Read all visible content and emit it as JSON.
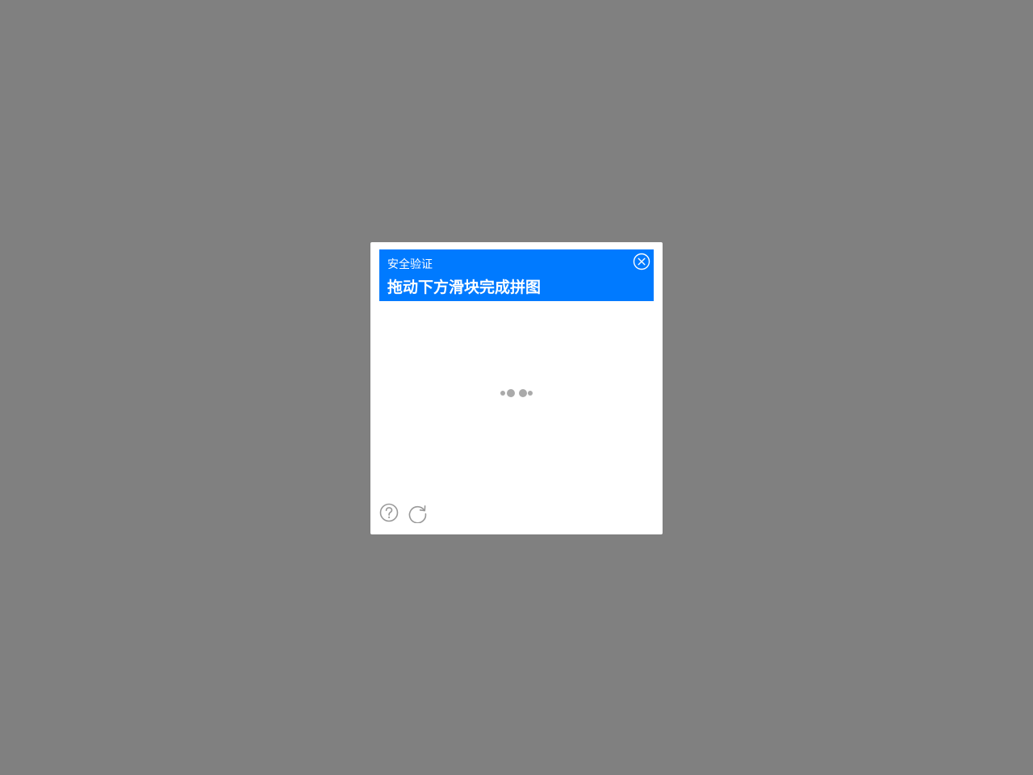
{
  "dialog": {
    "subtitle": "安全验证",
    "title": "拖动下方滑块完成拼图"
  },
  "icons": {
    "close": "close-circle-icon",
    "loader": "loading-dots-icon",
    "help": "help-circle-icon",
    "refresh": "refresh-icon"
  },
  "colors": {
    "overlay": "#808080",
    "header": "#007aff",
    "icon": "#999999"
  }
}
